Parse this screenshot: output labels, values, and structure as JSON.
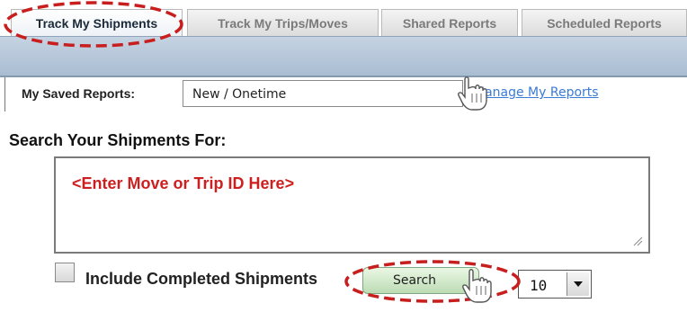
{
  "tabs": [
    {
      "label": "Track My Shipments",
      "active": true
    },
    {
      "label": "Track My Trips/Moves",
      "active": false
    },
    {
      "label": "Shared Reports",
      "active": false
    },
    {
      "label": "Scheduled Reports",
      "active": false
    }
  ],
  "saved_reports": {
    "label": "My Saved Reports:",
    "selected": "New / Onetime",
    "manage_link": "Manage My Reports"
  },
  "search": {
    "title": "Search Your Shipments For:",
    "placeholder": "<Enter Move or Trip ID Here>",
    "include_label": "Include Completed Shipments",
    "search_button": "Search",
    "page_size": "10"
  },
  "icons": {
    "hand_cursor": "hand-pointer-icon",
    "dropdown_arrow": "triangle-down-icon",
    "resize": "resize-grip-icon"
  },
  "colors": {
    "highlight_red": "#c81e1e",
    "placeholder_red": "#cc1f1f",
    "link_blue": "#3a7bd5",
    "bar_blue": "#b8c9db",
    "search_green": "#c7e3bf"
  }
}
